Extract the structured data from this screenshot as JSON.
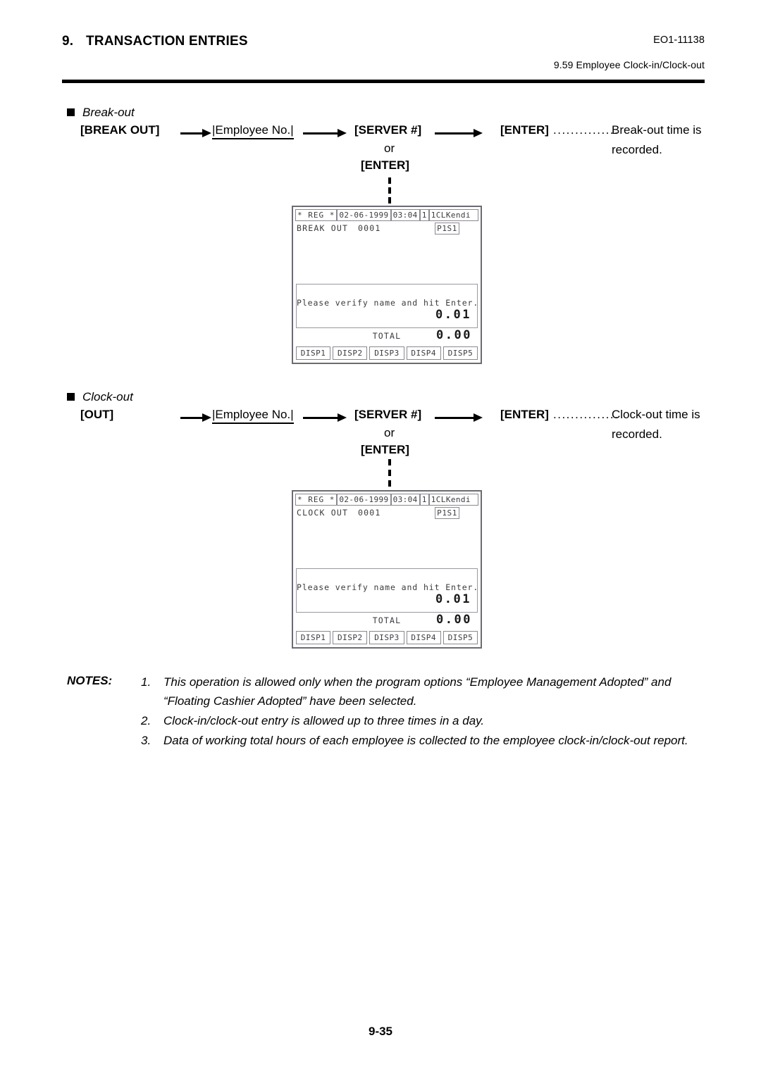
{
  "header": {
    "chapter_number": "9.",
    "chapter_title": "TRANSACTION ENTRIES",
    "doc_code": "EO1-11138",
    "section_ref": "9.59  Employee Clock-in/Clock-out"
  },
  "sections": [
    {
      "heading": "Break-out",
      "first_key": "[BREAK OUT]",
      "employee_field": "|Employee No.|",
      "server_key": "[SERVER #]",
      "or_label": "or",
      "alt_key": "[ENTER]",
      "final_key": "[ENTER]",
      "leader": "...............",
      "result_line1": "Break-out time is",
      "result_line2": "recorded.",
      "display": {
        "mode": "* REG *",
        "date": "02-06-1999",
        "time": "03:04",
        "register": "1",
        "clerk": "1CLKendi",
        "operation": "BREAK OUT",
        "operation_number": "0001",
        "ps_badge": "P1S1",
        "message": "Please verify name and hit Enter.",
        "message_amount": "0.01",
        "total_label": "TOTAL",
        "total_amount": "0.00",
        "disp_keys": [
          "DISP1",
          "DISP2",
          "DISP3",
          "DISP4",
          "DISP5"
        ]
      }
    },
    {
      "heading": "Clock-out",
      "first_key": "[OUT]",
      "employee_field": "|Employee No.|",
      "server_key": "[SERVER #]",
      "or_label": "or",
      "alt_key": "[ENTER]",
      "final_key": "[ENTER]",
      "leader": "...............",
      "result_line1": "Clock-out time is",
      "result_line2": "recorded.",
      "display": {
        "mode": "* REG *",
        "date": "02-06-1999",
        "time": "03:04",
        "register": "1",
        "clerk": "1CLKendi",
        "operation": "CLOCK OUT",
        "operation_number": "0001",
        "ps_badge": "P1S1",
        "message": "Please verify name and hit Enter.",
        "message_amount": "0.01",
        "total_label": "TOTAL",
        "total_amount": "0.00",
        "disp_keys": [
          "DISP1",
          "DISP2",
          "DISP3",
          "DISP4",
          "DISP5"
        ]
      }
    }
  ],
  "notes": {
    "label": "NOTES:",
    "items": [
      {
        "num": "1.",
        "text": "This operation is allowed only when the program options “Employee Management Adopted” and “Floating Cashier Adopted” have been selected."
      },
      {
        "num": "2.",
        "text": "Clock-in/clock-out entry is allowed up to three times in a day."
      },
      {
        "num": "3.",
        "text": "Data of working total hours of each employee is collected to the employee clock-in/clock-out report."
      }
    ]
  },
  "footer": {
    "page_number": "9-35"
  }
}
